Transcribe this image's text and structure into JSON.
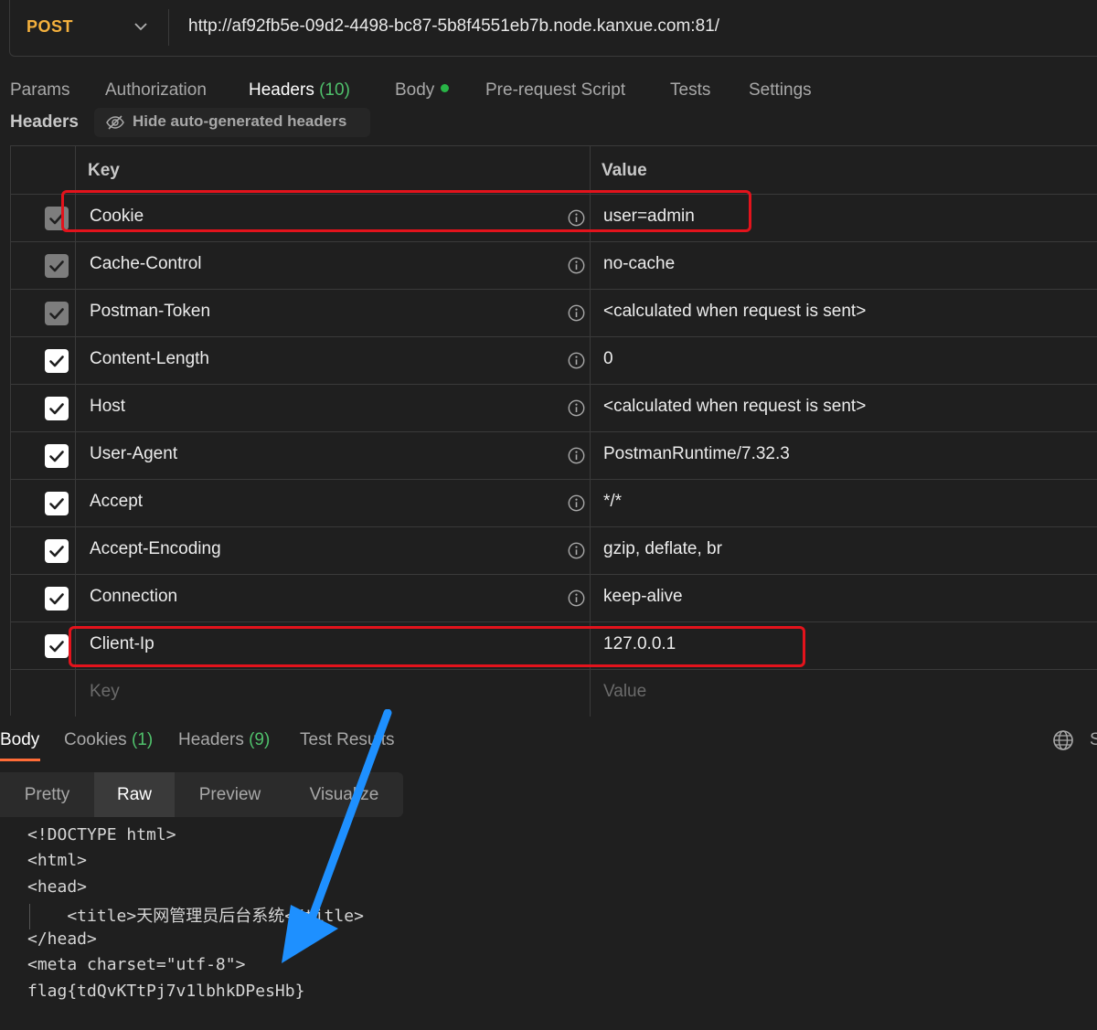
{
  "request": {
    "method": "POST",
    "url": "http://af92fb5e-09d2-4498-bc87-5b8f4551eb7b.node.kanxue.com:81/"
  },
  "tabs": {
    "params": "Params",
    "authorization": "Authorization",
    "headers": "Headers",
    "headers_count": "(10)",
    "body": "Body",
    "pre_request": "Pre-request Script",
    "tests": "Tests",
    "settings": "Settings"
  },
  "headers_section": {
    "label": "Headers",
    "hide_toggle": "Hide auto-generated headers",
    "col_key": "Key",
    "col_value": "Value",
    "rows": [
      {
        "key": "Cookie",
        "value": "user=admin",
        "auto": true
      },
      {
        "key": "Cache-Control",
        "value": "no-cache",
        "auto": true
      },
      {
        "key": "Postman-Token",
        "value": "<calculated when request is sent>",
        "auto": true
      },
      {
        "key": "Content-Length",
        "value": "0",
        "auto": false
      },
      {
        "key": "Host",
        "value": "<calculated when request is sent>",
        "auto": false
      },
      {
        "key": "User-Agent",
        "value": "PostmanRuntime/7.32.3",
        "auto": false
      },
      {
        "key": "Accept",
        "value": "*/*",
        "auto": false
      },
      {
        "key": "Accept-Encoding",
        "value": "gzip, deflate, br",
        "auto": false
      },
      {
        "key": "Connection",
        "value": "keep-alive",
        "auto": false
      },
      {
        "key": "Client-Ip",
        "value": "127.0.0.1",
        "auto": false
      }
    ],
    "new_row_key_placeholder": "Key",
    "new_row_value_placeholder": "Value"
  },
  "response": {
    "tabs": {
      "body": "Body",
      "cookies": "Cookies",
      "cookies_count": "(1)",
      "headers": "Headers",
      "headers_count": "(9)",
      "test_results": "Test Results"
    },
    "truncated_tab": "S",
    "views": [
      "Pretty",
      "Raw",
      "Preview",
      "Visualize"
    ],
    "active_view": "Raw",
    "body_lines": [
      "<!DOCTYPE html>",
      "<html>",
      "<head>",
      "    <title>天网管理员后台系统</title>",
      "</head>",
      "<meta charset=\"utf-8\">",
      "flag{tdQvKTtPj7v1lbhkDPesHb}"
    ]
  },
  "colors": {
    "method": "#f5b13d",
    "accent_underline": "#ff6c37",
    "count_green": "#4fc06b",
    "highlight_red": "#e3131c",
    "arrow_blue": "#1e90ff"
  }
}
